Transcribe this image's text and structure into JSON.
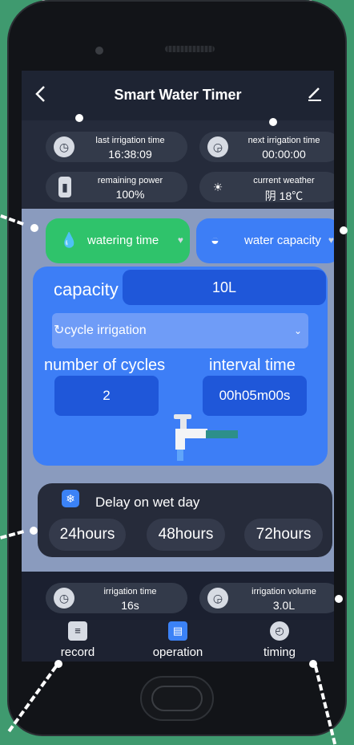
{
  "header": {
    "title": "Smart Water Timer",
    "back_icon": "chevron-left-icon",
    "edit_icon": "edit-icon"
  },
  "status": {
    "last_irrigation": {
      "label": "last irrigation time",
      "value": "16:38:09",
      "icon": "clock-back-icon"
    },
    "next_irrigation": {
      "label": "next irrigation time",
      "value": "00:00:00",
      "icon": "clock-forward-icon"
    },
    "power": {
      "label": "remaining power",
      "value": "100%",
      "icon": "battery-icon"
    },
    "weather": {
      "label": "current weather",
      "value": "阴 18℃",
      "icon": "sun-icon"
    }
  },
  "tabs": [
    {
      "label": "watering time",
      "icon": "water-drops-icon",
      "active": true,
      "color": "#2fc36b"
    },
    {
      "label": "water capacity",
      "icon": "water-bowl-icon",
      "active": false,
      "color": "#3d7ef6"
    }
  ],
  "capacity": {
    "label": "capacity",
    "value": "10L"
  },
  "mode": {
    "selected": "cycle irrigation",
    "icon": "cycle-icon"
  },
  "cycles": {
    "label": "number of cycles",
    "value": "2"
  },
  "interval": {
    "label": "interval time",
    "value": "00h05m00s"
  },
  "delay": {
    "title": "Delay on wet day",
    "icon": "snowflake-icon",
    "options": [
      "24hours",
      "48hours",
      "72hours"
    ]
  },
  "summary": {
    "irrigation_time": {
      "label": "irrigation time",
      "value": "16s",
      "icon": "clock-back-icon"
    },
    "irrigation_volume": {
      "label": "irrigation volume",
      "value": "3.0L",
      "icon": "clock-forward-icon"
    }
  },
  "nav": [
    {
      "label": "record",
      "icon": "document-icon"
    },
    {
      "label": "operation",
      "icon": "operation-icon",
      "active": true
    },
    {
      "label": "timing",
      "icon": "clock-icon"
    }
  ],
  "colors": {
    "accent_blue": "#3d7ef6",
    "accent_green": "#2fc36b",
    "dark_bg": "#1e2433"
  }
}
